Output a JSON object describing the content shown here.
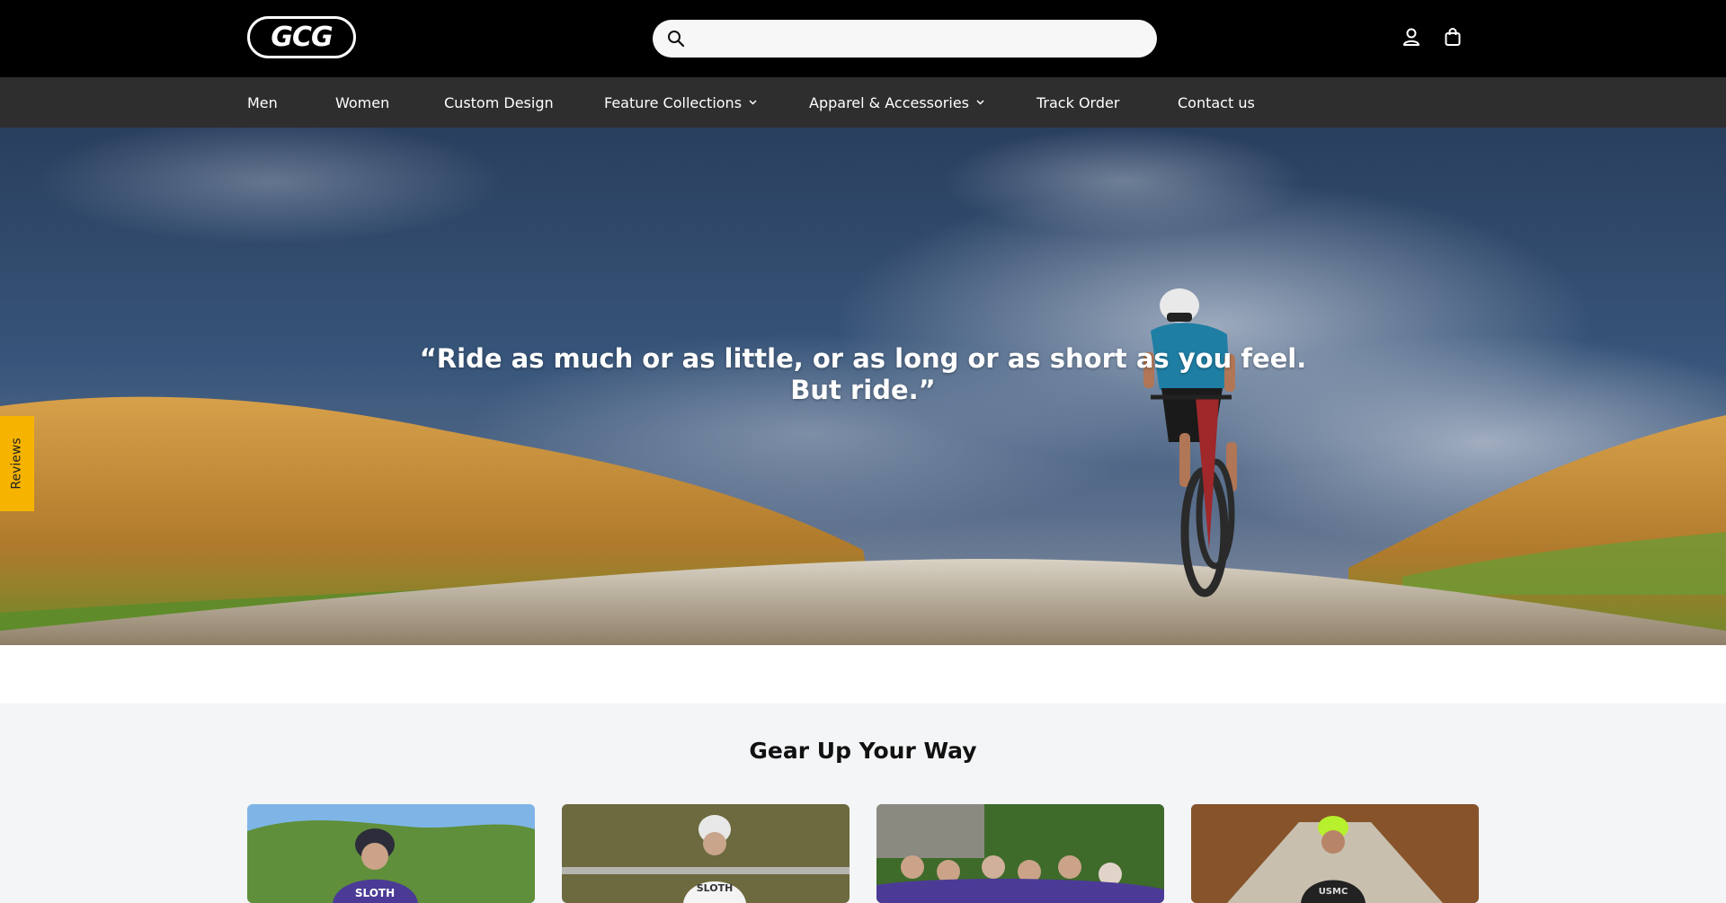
{
  "header": {
    "logo_text": "GCG",
    "search": {
      "placeholder": "",
      "value": ""
    },
    "icons": [
      "search-icon",
      "account-icon",
      "cart-icon"
    ]
  },
  "nav": {
    "items": [
      {
        "label": "Men",
        "dropdown": false
      },
      {
        "label": "Women",
        "dropdown": false
      },
      {
        "label": "Custom Design",
        "dropdown": false
      },
      {
        "label": "Feature Collections",
        "dropdown": true
      },
      {
        "label": "Apparel & Accessories",
        "dropdown": true
      },
      {
        "label": "Track Order",
        "dropdown": false
      },
      {
        "label": "Contact us",
        "dropdown": false
      }
    ],
    "chevron": "⌄"
  },
  "hero": {
    "quote_line1": "“Ride as much or as little, or as long or as short as you feel.",
    "quote_line2": "But ride.”"
  },
  "reviews_tab": {
    "label": "Reviews"
  },
  "section": {
    "title": "Gear Up Your Way"
  },
  "colors": {
    "topbar": "#000000",
    "navbar": "#2e2e2e",
    "reviews_tab": "#f6b400",
    "page_bg": "#f4f5f7"
  }
}
